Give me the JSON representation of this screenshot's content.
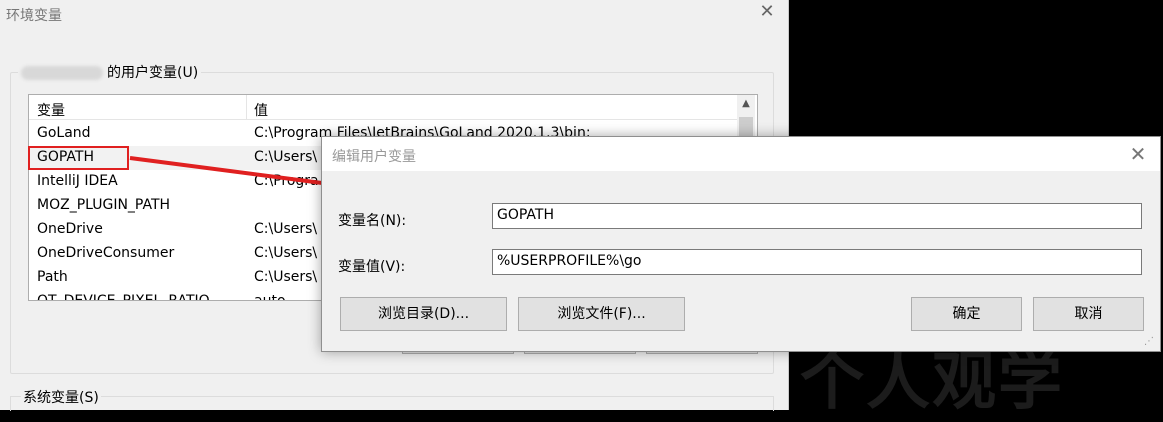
{
  "env_window": {
    "title": "环境变量",
    "close_glyph": "✕",
    "user_vars_legend": "的用户变量(U)",
    "system_vars_legend": "系统变量(S)",
    "columns": [
      "变量",
      "值"
    ],
    "rows": [
      {
        "name": "GoLand",
        "value": "C:\\Program Files\\JetBrains\\GoLand 2020.1.3\\bin;"
      },
      {
        "name": "GOPATH",
        "value": "C:\\Users\\"
      },
      {
        "name": "IntelliJ IDEA",
        "value": "C:\\Progra"
      },
      {
        "name": "MOZ_PLUGIN_PATH",
        "value": ""
      },
      {
        "name": "OneDrive",
        "value": "C:\\Users\\"
      },
      {
        "name": "OneDriveConsumer",
        "value": "C:\\Users\\"
      },
      {
        "name": "Path",
        "value": "C:\\Users\\"
      },
      {
        "name": "QT_DEVICE_PIXEL_RATIO",
        "value": "auto"
      }
    ],
    "selected_row": "GOPATH"
  },
  "edit_dialog": {
    "title": "编辑用户变量",
    "close_glyph": "✕",
    "name_label": "变量名(N):",
    "name_value": "GOPATH",
    "value_label": "变量值(V):",
    "value_value": "%USERPROFILE%\\go",
    "buttons": {
      "browse_dir": "浏览目录(D)...",
      "browse_file": "浏览文件(F)...",
      "ok": "确定",
      "cancel": "取消"
    }
  },
  "watermark": "个人观学",
  "colors": {
    "highlight": "#e02020",
    "window_bg": "#f0f0f0"
  }
}
